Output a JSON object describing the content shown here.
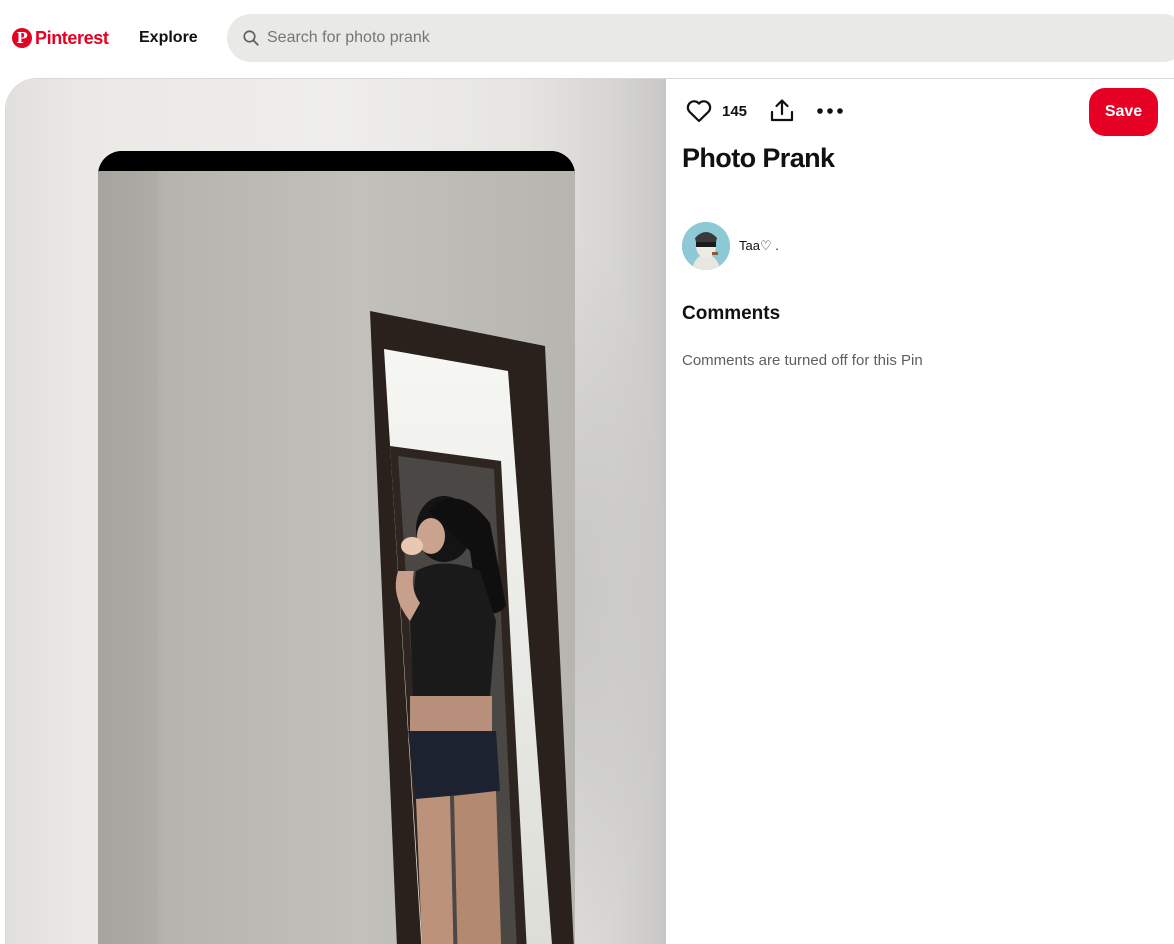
{
  "brand": {
    "name": "Pinterest",
    "logo_letter": "P",
    "color": "#e60023"
  },
  "nav": {
    "explore_label": "Explore"
  },
  "search": {
    "placeholder": "Search for photo prank",
    "value": ""
  },
  "pin": {
    "title": "Photo Prank",
    "like_count": "145",
    "save_label": "Save",
    "author": {
      "name": "Taa♡ ."
    },
    "comments": {
      "heading": "Comments",
      "status": "Comments are turned off for this Pin"
    }
  },
  "icons": [
    "pinterest-logo-icon",
    "search-icon",
    "heart-icon",
    "share-icon",
    "more-options-icon"
  ],
  "colors": {
    "accent": "#e60023",
    "search_bg": "#e9e9e5",
    "muted_text": "#5f5f5f"
  }
}
